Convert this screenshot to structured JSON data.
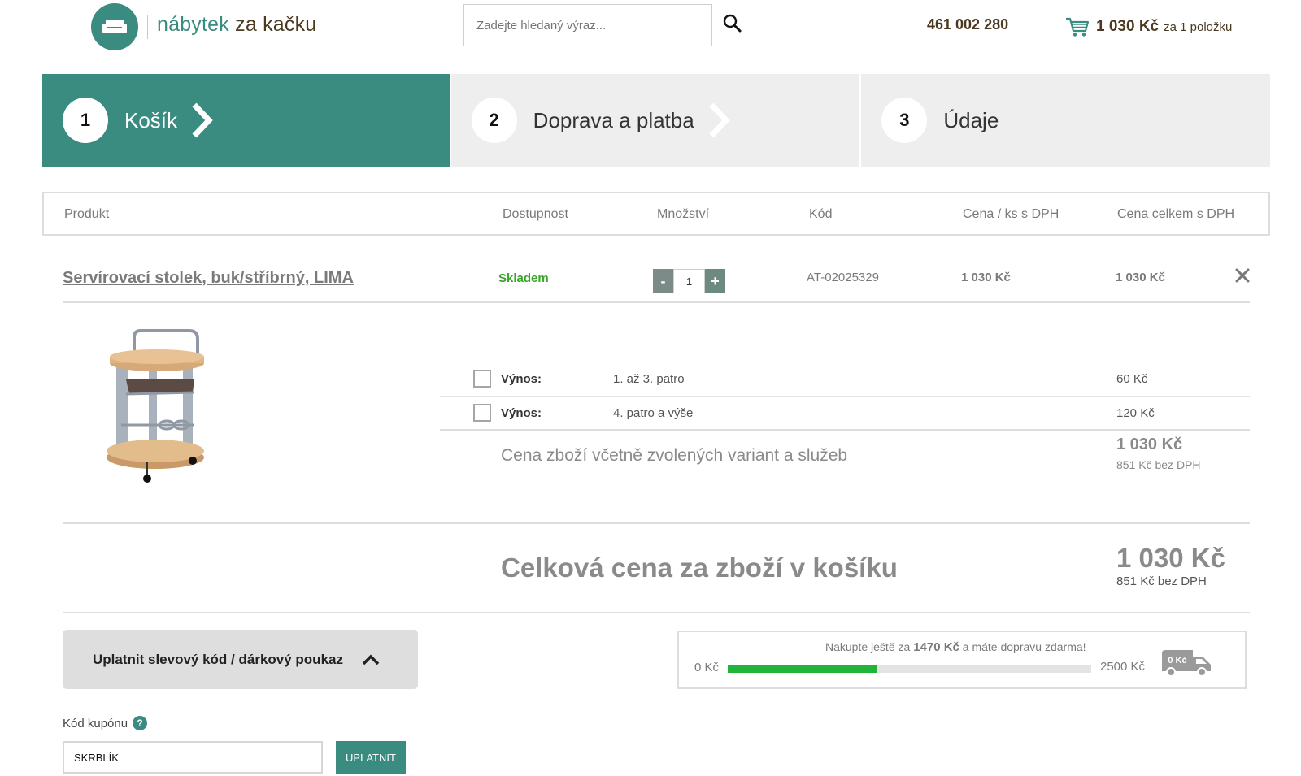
{
  "header": {
    "logo_text_1": "nábytek",
    "logo_text_2": "za kačku",
    "search_placeholder": "Zadejte hledaný výraz...",
    "phone": "461 002 280",
    "cart_total": "1 030 Kč",
    "cart_items": "za 1 položku"
  },
  "steps": [
    {
      "num": "1",
      "label": "Košík"
    },
    {
      "num": "2",
      "label": "Doprava a platba"
    },
    {
      "num": "3",
      "label": "Údaje"
    }
  ],
  "table_head": {
    "product": "Produkt",
    "availability": "Dostupnost",
    "quantity": "Množství",
    "code": "Kód",
    "unit_price": "Cena / ks s DPH",
    "total_price": "Cena celkem s DPH"
  },
  "product": {
    "name": "Servírovací stolek, buk/stříbrný, LIMA",
    "stock": "Skladem",
    "quantity": "1",
    "minus": "-",
    "plus": "+",
    "code": "AT-02025329",
    "unit_price": "1 030 Kč",
    "total_price": "1 030 Kč"
  },
  "services": [
    {
      "label": "Výnos:",
      "desc": "1. až 3. patro",
      "price": "60 Kč",
      "checked": false
    },
    {
      "label": "Výnos:",
      "desc": "4. patro a výše",
      "price": "120 Kč",
      "checked": false
    }
  ],
  "subtotal": {
    "label": "Cena zboží včetně zvolených variant a služeb",
    "price": "1 030 Kč",
    "net": "851 Kč bez DPH"
  },
  "grand_total": {
    "label": "Celková cena za zboží v košíku",
    "price": "1 030 Kč",
    "net": "851 Kč bez DPH"
  },
  "coupon": {
    "toggle_label": "Uplatnit slevový kód / dárkový poukaz",
    "field_label": "Kód kupónu",
    "help": "?",
    "value": "SKRBLÍK",
    "button": "UPLATNIT"
  },
  "shipping": {
    "msg_prefix": "Nakupte ještě za",
    "remaining": "1470 Kč",
    "msg_suffix": "a máte dopravu zdarma!",
    "min_label": "0 Kč",
    "max_label": "2500 Kč",
    "van_label": "0 Kč",
    "progress": 1030,
    "progress_max": 2500
  },
  "colors": {
    "accent": "#3a8c80",
    "stock_green": "#3aa52a",
    "progress_green": "#21b43a",
    "brand_brown": "#4b3a21"
  }
}
